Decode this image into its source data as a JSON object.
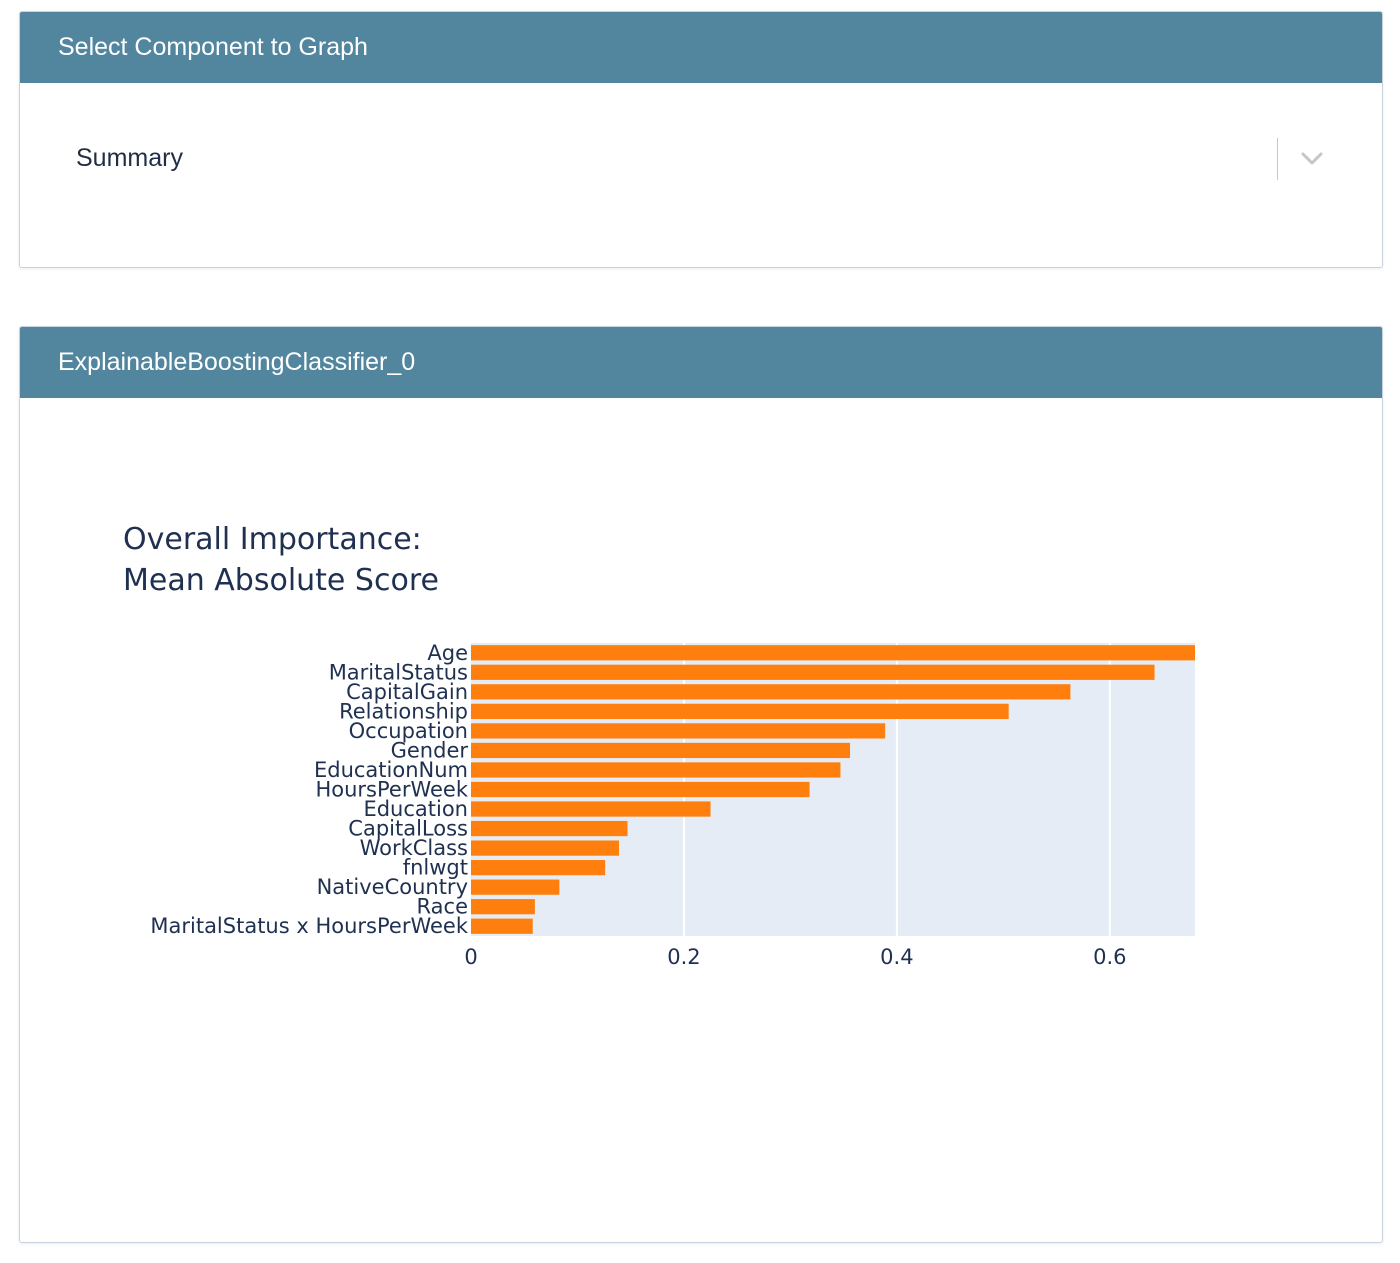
{
  "selector": {
    "header": "Select Component to Graph",
    "value": "Summary"
  },
  "graph_panel": {
    "header": "ExplainableBoostingClassifier_0"
  },
  "colors": {
    "header_bg": "#52869f",
    "bar": "#ff7f0e",
    "plot_bg": "#e5ecf6",
    "grid": "#ffffff",
    "text": "#1f3050"
  },
  "chart_data": {
    "type": "bar",
    "orientation": "horizontal",
    "title_lines": [
      "Overall Importance:",
      "Mean Absolute Score"
    ],
    "categories": [
      "Age",
      "MaritalStatus",
      "CapitalGain",
      "Relationship",
      "Occupation",
      "Gender",
      "EducationNum",
      "HoursPerWeek",
      "Education",
      "CapitalLoss",
      "WorkClass",
      "fnlwgt",
      "NativeCountry",
      "Race",
      "MaritalStatus x HoursPerWeek"
    ],
    "values": [
      0.68,
      0.642,
      0.563,
      0.505,
      0.389,
      0.356,
      0.347,
      0.318,
      0.225,
      0.147,
      0.139,
      0.126,
      0.083,
      0.06,
      0.058
    ],
    "xlim": [
      0,
      0.68
    ],
    "xticks": [
      0,
      0.2,
      0.4,
      0.6
    ],
    "xtick_labels": [
      "0",
      "0.2",
      "0.4",
      "0.6"
    ],
    "grid": true
  }
}
